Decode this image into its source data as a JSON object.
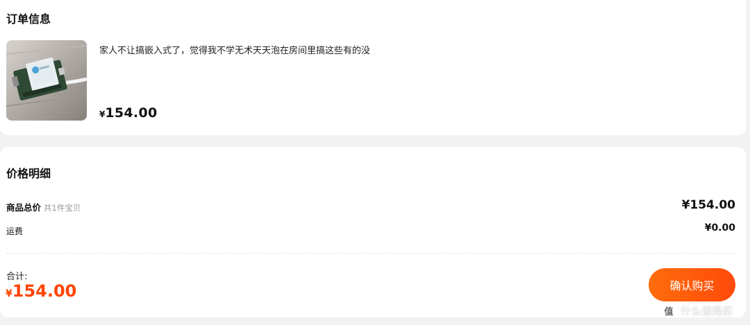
{
  "order_info": {
    "title": "订单信息",
    "product": {
      "description": "家人不让搞嵌入式了，觉得我不学无术天天泡在房间里搞这些有的没",
      "currency": "¥",
      "price": "154.00"
    }
  },
  "price_details": {
    "title": "价格明细",
    "goods_total_label": "商品总价",
    "goods_count_text": "共1件宝贝",
    "goods_total_value": "¥154.00",
    "shipping_label": "运费",
    "shipping_value": "¥0.00",
    "total_label": "合计:",
    "total_currency": "¥",
    "total_amount": "154.00",
    "confirm_button_label": "确认购买"
  },
  "watermark": {
    "icon_text": "值",
    "text": "什么值得买"
  },
  "colors": {
    "accent": "#ff4400",
    "button_start": "#ff6d0d",
    "button_end": "#ff4a0a"
  },
  "icons": {
    "watermark_icon": "smzdm-logo-icon"
  }
}
